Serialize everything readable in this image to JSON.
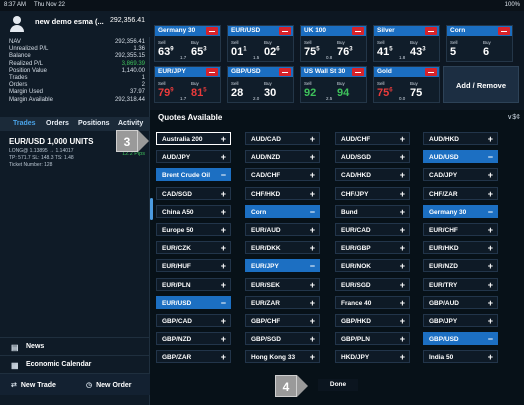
{
  "status": {
    "time": "8:37 AM",
    "date": "Thu Nov 22",
    "battery": "100%"
  },
  "account": {
    "name": "new demo esma (...",
    "value": "292,356.41",
    "metrics": [
      {
        "label": "NAV",
        "value": "292,356.41",
        "color": ""
      },
      {
        "label": "Unrealized P/L",
        "value": "1.36",
        "color": ""
      },
      {
        "label": "Balance",
        "value": "292,355.15",
        "color": ""
      },
      {
        "label": "Realized P/L",
        "value": "3,869.39",
        "color": "green"
      },
      {
        "label": "Position Value",
        "value": "1,140.00",
        "color": ""
      },
      {
        "label": "Trades",
        "value": "1",
        "color": ""
      },
      {
        "label": "Orders",
        "value": "2",
        "color": ""
      },
      {
        "label": "Margin Used",
        "value": "37.97",
        "color": ""
      },
      {
        "label": "Margin Available",
        "value": "292,318.44",
        "color": ""
      }
    ]
  },
  "tabs": [
    "Trades",
    "Orders",
    "Positions",
    "Activity"
  ],
  "trade": {
    "title": "EUR/USD  1,000 UNITS",
    "line1": "LONG@ 1.13895  → 1.14017",
    "line2": "TP: 571.7  SL: 148.3  TS: 1.48",
    "pips": "12.2 Pips",
    "line3": "Ticket Number: 128"
  },
  "left_bottom": {
    "news": "News",
    "calendar": "Economic Calendar",
    "new_trade": "New Trade",
    "new_order": "New Order"
  },
  "tiles": [
    {
      "name": "Germany 30",
      "sell_label": "Sell",
      "buy_label": "Buy",
      "sell": "63",
      "sell_small": "9",
      "buy": "65",
      "buy_small": "3",
      "spread": "1.7",
      "sell_color": "",
      "buy_color": ""
    },
    {
      "name": "EUR/USD",
      "sell_label": "Sell",
      "buy_label": "Buy",
      "sell": "01",
      "sell_small": "1",
      "buy": "02",
      "buy_small": "6",
      "spread": "1.5",
      "sell_color": "",
      "buy_color": ""
    },
    {
      "name": "UK 100",
      "sell_label": "Sell",
      "buy_label": "Buy",
      "sell": "75",
      "sell_small": "5",
      "buy": "76",
      "buy_small": "3",
      "spread": "0.8",
      "sell_color": "",
      "buy_color": ""
    },
    {
      "name": "Silver",
      "sell_label": "Sell",
      "buy_label": "Buy",
      "sell": "41",
      "sell_small": "5",
      "buy": "43",
      "buy_small": "3",
      "spread": "1.8",
      "sell_color": "",
      "buy_color": ""
    },
    {
      "name": "Corn",
      "sell_label": "Sell",
      "buy_label": "Buy",
      "sell": "5",
      "sell_small": "",
      "buy": "6",
      "buy_small": "",
      "spread": "",
      "sell_color": "",
      "buy_color": ""
    },
    {
      "name": "EUR/JPY",
      "sell_label": "Sell",
      "buy_label": "Buy",
      "sell": "79",
      "sell_small": "9",
      "buy": "81",
      "buy_small": "5",
      "spread": "1.7",
      "sell_color": "red",
      "buy_color": "red"
    },
    {
      "name": "GBP/USD",
      "sell_label": "Sell",
      "buy_label": "Buy",
      "sell": "28",
      "sell_small": "",
      "buy": "30",
      "buy_small": "",
      "spread": "2.0",
      "sell_color": "",
      "buy_color": ""
    },
    {
      "name": "US Wall St 30",
      "sell_label": "Sell",
      "buy_label": "Buy",
      "sell": "92",
      "sell_small": "",
      "buy": "94",
      "buy_small": "",
      "spread": "2.5",
      "sell_color": "green",
      "buy_color": "green"
    },
    {
      "name": "Gold",
      "sell_label": "Sell",
      "buy_label": "Buy",
      "sell": "75",
      "sell_small": "6",
      "buy": "75",
      "buy_small": "",
      "spread": "0.0",
      "sell_color": "red",
      "buy_color": ""
    }
  ],
  "add_remove_label": "Add / Remove",
  "dialog": {
    "title": "Quotes Available",
    "right_icon": "∨$¢",
    "done_label": "Done",
    "instruments": [
      {
        "label": "Australia 200",
        "state": "add",
        "selected": false,
        "focus": true
      },
      {
        "label": "AUD/CAD",
        "state": "add",
        "selected": false,
        "focus": false
      },
      {
        "label": "AUD/CHF",
        "state": "add",
        "selected": false,
        "focus": false
      },
      {
        "label": "AUD/HKD",
        "state": "add",
        "selected": false,
        "focus": false
      },
      {
        "label": "AUD/JPY",
        "state": "add",
        "selected": false,
        "focus": false
      },
      {
        "label": "AUD/NZD",
        "state": "add",
        "selected": false,
        "focus": false
      },
      {
        "label": "AUD/SGD",
        "state": "add",
        "selected": false,
        "focus": false
      },
      {
        "label": "AUD/USD",
        "state": "remove",
        "selected": true,
        "focus": false
      },
      {
        "label": "Brent Crude Oil",
        "state": "remove",
        "selected": true,
        "focus": false
      },
      {
        "label": "CAD/CHF",
        "state": "add",
        "selected": false,
        "focus": false
      },
      {
        "label": "CAD/HKD",
        "state": "add",
        "selected": false,
        "focus": false
      },
      {
        "label": "CAD/JPY",
        "state": "add",
        "selected": false,
        "focus": false
      },
      {
        "label": "CAD/SGD",
        "state": "add",
        "selected": false,
        "focus": false
      },
      {
        "label": "CHF/HKD",
        "state": "add",
        "selected": false,
        "focus": false
      },
      {
        "label": "CHF/JPY",
        "state": "add",
        "selected": false,
        "focus": false
      },
      {
        "label": "CHF/ZAR",
        "state": "add",
        "selected": false,
        "focus": false
      },
      {
        "label": "China A50",
        "state": "add",
        "selected": false,
        "focus": false
      },
      {
        "label": "Corn",
        "state": "remove",
        "selected": true,
        "focus": false
      },
      {
        "label": "Bund",
        "state": "add",
        "selected": false,
        "focus": false
      },
      {
        "label": "Germany 30",
        "state": "remove",
        "selected": true,
        "focus": false
      },
      {
        "label": "Europe 50",
        "state": "add",
        "selected": false,
        "focus": false
      },
      {
        "label": "EUR/AUD",
        "state": "add",
        "selected": false,
        "focus": false
      },
      {
        "label": "EUR/CAD",
        "state": "add",
        "selected": false,
        "focus": false
      },
      {
        "label": "EUR/CHF",
        "state": "add",
        "selected": false,
        "focus": false
      },
      {
        "label": "EUR/CZK",
        "state": "add",
        "selected": false,
        "focus": false
      },
      {
        "label": "EUR/DKK",
        "state": "add",
        "selected": false,
        "focus": false
      },
      {
        "label": "EUR/GBP",
        "state": "add",
        "selected": false,
        "focus": false
      },
      {
        "label": "EUR/HKD",
        "state": "add",
        "selected": false,
        "focus": false
      },
      {
        "label": "EUR/HUF",
        "state": "add",
        "selected": false,
        "focus": false
      },
      {
        "label": "EUR/JPY",
        "state": "remove",
        "selected": true,
        "focus": false
      },
      {
        "label": "EUR/NOK",
        "state": "add",
        "selected": false,
        "focus": false
      },
      {
        "label": "EUR/NZD",
        "state": "add",
        "selected": false,
        "focus": false
      },
      {
        "label": "EUR/PLN",
        "state": "add",
        "selected": false,
        "focus": false
      },
      {
        "label": "EUR/SEK",
        "state": "add",
        "selected": false,
        "focus": false
      },
      {
        "label": "EUR/SGD",
        "state": "add",
        "selected": false,
        "focus": false
      },
      {
        "label": "EUR/TRY",
        "state": "add",
        "selected": false,
        "focus": false
      },
      {
        "label": "EUR/USD",
        "state": "remove",
        "selected": true,
        "focus": false
      },
      {
        "label": "EUR/ZAR",
        "state": "add",
        "selected": false,
        "focus": false
      },
      {
        "label": "France 40",
        "state": "add",
        "selected": false,
        "focus": false
      },
      {
        "label": "GBP/AUD",
        "state": "add",
        "selected": false,
        "focus": false
      },
      {
        "label": "GBP/CAD",
        "state": "add",
        "selected": false,
        "focus": false
      },
      {
        "label": "GBP/CHF",
        "state": "add",
        "selected": false,
        "focus": false
      },
      {
        "label": "GBP/HKD",
        "state": "add",
        "selected": false,
        "focus": false
      },
      {
        "label": "GBP/JPY",
        "state": "add",
        "selected": false,
        "focus": false
      },
      {
        "label": "GBP/NZD",
        "state": "add",
        "selected": false,
        "focus": false
      },
      {
        "label": "GBP/SGD",
        "state": "add",
        "selected": false,
        "focus": false
      },
      {
        "label": "GBP/PLN",
        "state": "add",
        "selected": false,
        "focus": false
      },
      {
        "label": "GBP/USD",
        "state": "remove",
        "selected": true,
        "focus": false
      },
      {
        "label": "GBP/ZAR",
        "state": "add",
        "selected": false,
        "focus": false
      },
      {
        "label": "Hong Kong 33",
        "state": "add",
        "selected": false,
        "focus": false
      },
      {
        "label": "HKD/JPY",
        "state": "add",
        "selected": false,
        "focus": false
      },
      {
        "label": "India 50",
        "state": "add",
        "selected": false,
        "focus": false
      }
    ]
  },
  "callouts": [
    "3",
    "4"
  ],
  "colors": {
    "accent": "#1c6fc2",
    "remove": "#d8232a",
    "green": "#3ec15b"
  }
}
